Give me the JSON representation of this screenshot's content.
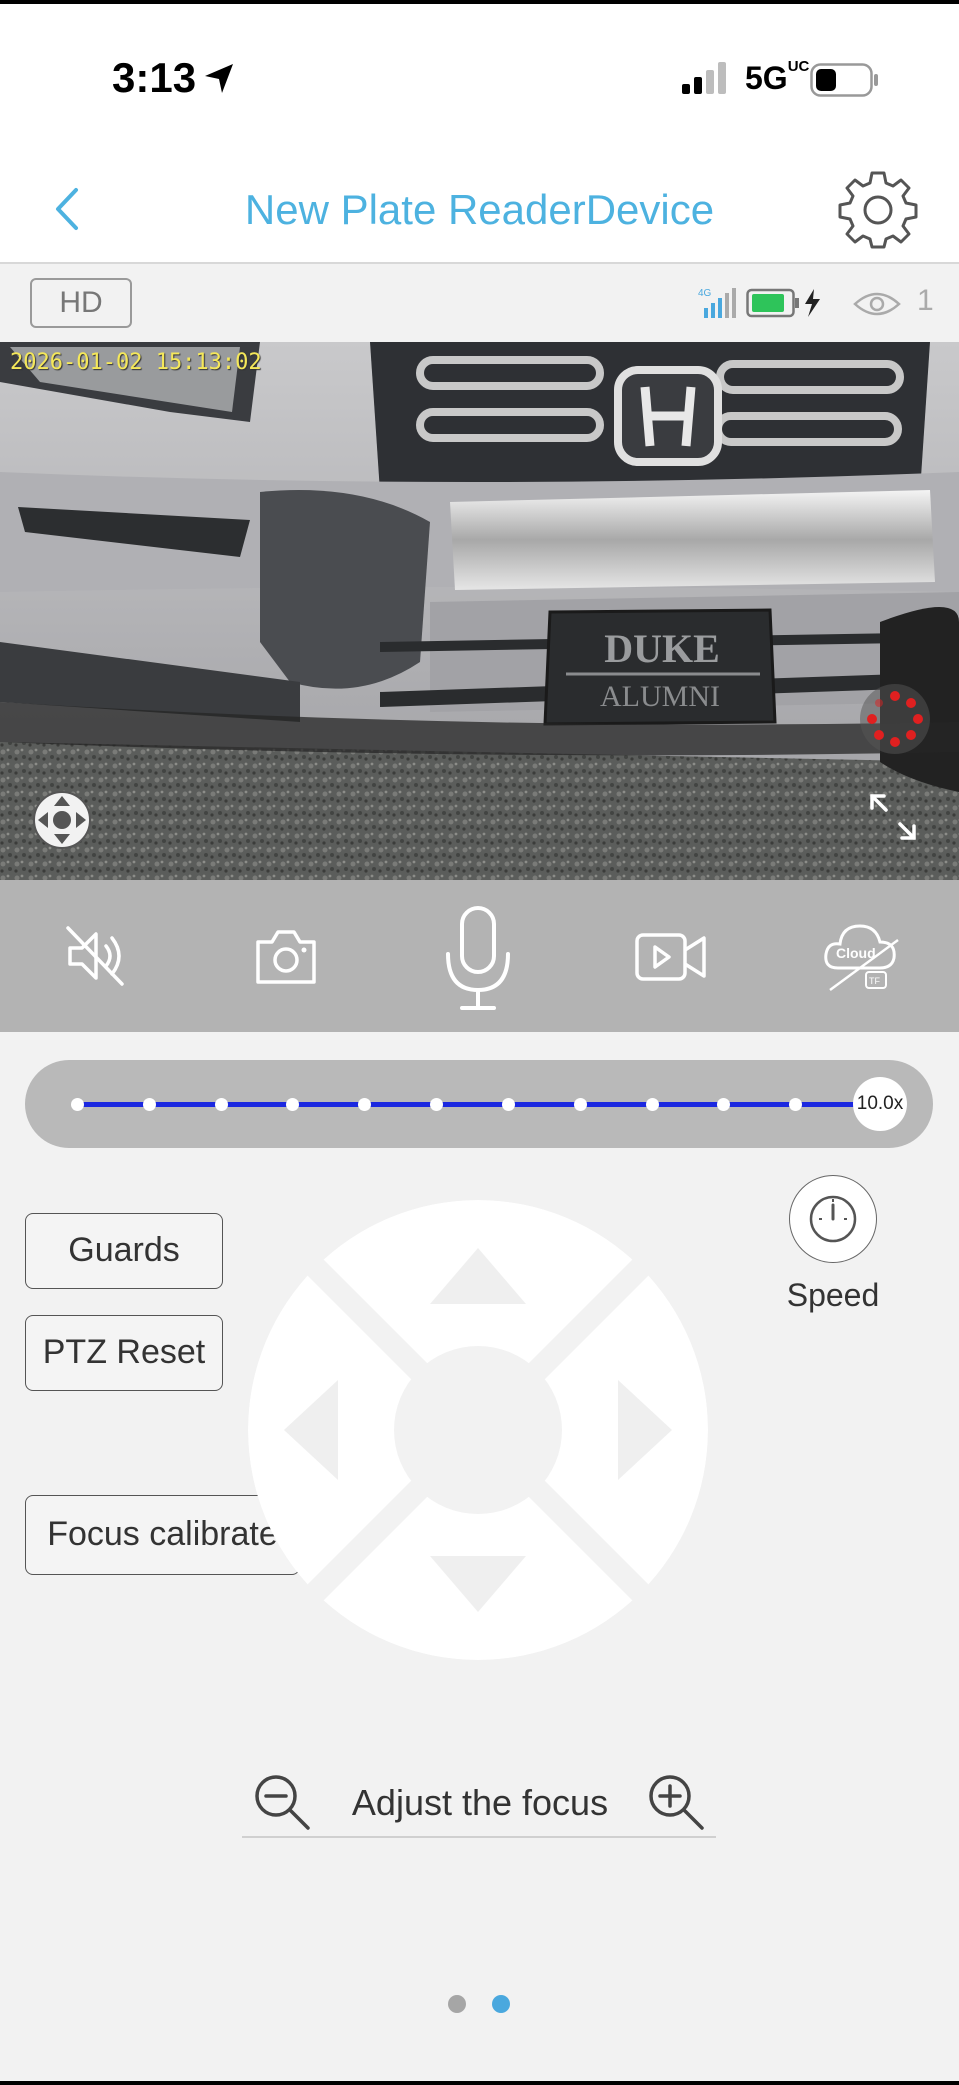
{
  "status_bar": {
    "time": "3:13",
    "network": "5G",
    "network_suffix": "UC"
  },
  "header": {
    "title": "New Plate ReaderDevice",
    "back_icon": "chevron-left-icon",
    "settings_icon": "gear-icon",
    "accent_color": "#4db2e0"
  },
  "video_info": {
    "quality_label": "HD",
    "network_badge": "4G",
    "viewer_count": "1"
  },
  "video": {
    "osd_timestamp": "2026-01-02 15:13:02",
    "plate_line1": "DUKE",
    "plate_line2": "ALUMNI"
  },
  "toolbar": {
    "items": [
      {
        "name": "mute",
        "icon": "speaker-muted-icon"
      },
      {
        "name": "snapshot",
        "icon": "camera-icon"
      },
      {
        "name": "talk",
        "icon": "microphone-icon"
      },
      {
        "name": "record",
        "icon": "video-record-icon"
      },
      {
        "name": "cloud",
        "icon": "cloud-icon",
        "label": "Cloud",
        "sublabel": "TF"
      }
    ]
  },
  "zoom": {
    "value_label": "10.0x",
    "value": 10.0,
    "level_fraction": 1.0,
    "track_color": "#1b28e0",
    "steps": 12
  },
  "controls": {
    "guards_label": "Guards",
    "ptz_reset_label": "PTZ Reset",
    "focus_calibrate_label": "Focus calibrate",
    "speed_label": "Speed"
  },
  "focus": {
    "label": "Adjust the focus",
    "minus_icon": "zoom-out-icon",
    "plus_icon": "zoom-in-icon"
  },
  "pager": {
    "pages": 2,
    "active": 2,
    "active_color": "#4aa8de"
  }
}
